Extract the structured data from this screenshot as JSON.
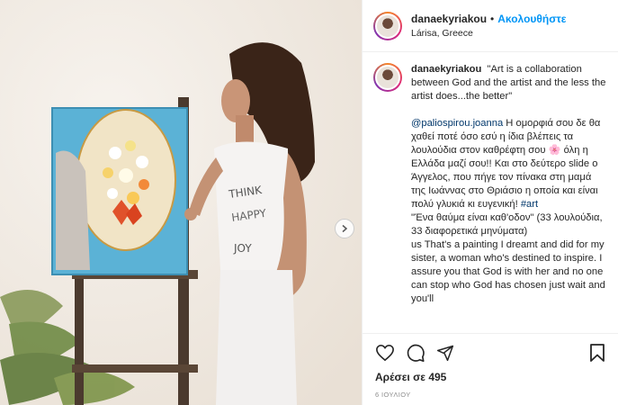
{
  "header": {
    "username": "danaekyriakou",
    "separator": "•",
    "follow_label": "Ακολουθήστε",
    "location": "Lárisa, Greece"
  },
  "caption": {
    "username": "danaekyriakou",
    "quote": "\"Art is a collaboration between God and the artist and the less the artist does...the better\"",
    "mention": "@paliospirou.joanna",
    "greek_text_1": " Η ομορφιά σου δε θα χαθεί ποτέ όσο εσύ η ίδια βλέπεις τα λουλούδια στον καθρέφτη σου 🌸 όλη η Ελλάδα μαζί σου!! Και στο δεύτερο slide ο Άγγελος, που πήγε τον πίνακα στη μαμά της Ιωάννας στο Θριάσιο η οποία και είναι πολύ γλυκιά κι ευγενική! ",
    "hashtag": "#art",
    "greek_text_2": "\"Ένα θαύμα είναι καθ'οδον\" (33 λουλούδια, 33 διαφορετικά μηνύματα)",
    "english_text": "us That's a painting I dreamt and did for my sister, a woman who's destined to inspire. I assure you that God is with her and no one can stop who God has chosen just wait and you'll"
  },
  "likes_label": "Αρέσει σε 495",
  "date_label": "6 ΙΟΥΛΙΟΥ",
  "colors": {
    "accent": "#0095f6",
    "text": "#262626",
    "link": "#00376b",
    "muted": "#8e8e8e"
  },
  "icons": [
    "heart-icon",
    "comment-icon",
    "share-icon",
    "save-icon",
    "chevron-right-icon"
  ]
}
